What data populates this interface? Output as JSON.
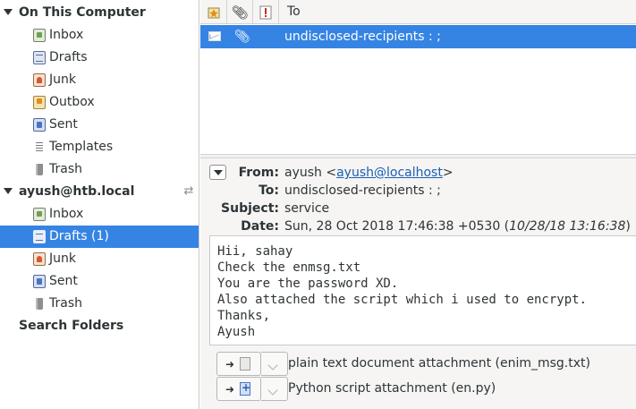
{
  "sidebar": {
    "accounts": [
      {
        "name": "On This Computer",
        "folders": [
          {
            "label": "Inbox",
            "icon": "inbox-icon"
          },
          {
            "label": "Drafts",
            "icon": "drafts-icon"
          },
          {
            "label": "Junk",
            "icon": "junk-icon"
          },
          {
            "label": "Outbox",
            "icon": "outbox-icon"
          },
          {
            "label": "Sent",
            "icon": "sent-icon"
          },
          {
            "label": "Templates",
            "icon": "templates-icon"
          },
          {
            "label": "Trash",
            "icon": "trash-icon"
          }
        ]
      },
      {
        "name": "ayush@htb.local",
        "folders": [
          {
            "label": "Inbox",
            "icon": "inbox-icon"
          },
          {
            "label": "Drafts (1)",
            "icon": "drafts-icon",
            "selected": true
          },
          {
            "label": "Junk",
            "icon": "junk-icon"
          },
          {
            "label": "Sent",
            "icon": "sent-icon"
          },
          {
            "label": "Trash",
            "icon": "trash-icon"
          }
        ]
      }
    ],
    "search_folders": "Search Folders"
  },
  "message_list": {
    "columns": {
      "to": "To"
    },
    "rows": [
      {
        "to": "undisclosed-recipients : ;",
        "has_attachment": true,
        "selected": true
      }
    ]
  },
  "preview": {
    "headers": {
      "from_label": "From:",
      "from_name": "ayush <",
      "from_email": "ayush@localhost",
      "from_suffix": ">",
      "to_label": "To:",
      "to_value": "undisclosed-recipients : ;",
      "subject_label": "Subject:",
      "subject_value": "service",
      "date_label": "Date:",
      "date_value": "Sun, 28 Oct 2018 17:46:38 +0530 (",
      "date_local": "10/28/18 13:16:38",
      "date_suffix": ")"
    },
    "body_lines": [
      "Hii, sahay",
      "Check the enmsg.txt",
      "You are the password XD.",
      "Also attached the script which i used to encrypt.",
      "Thanks,",
      "Ayush"
    ],
    "attachments": [
      {
        "label": "plain text document attachment (enim_msg.txt)",
        "icon": "text-document-icon"
      },
      {
        "label": "Python script attachment (en.py)",
        "icon": "python-script-icon"
      }
    ]
  },
  "colors": {
    "selection": "#3584e4",
    "link": "#1a5fb4",
    "panel": "#f6f5f4"
  }
}
